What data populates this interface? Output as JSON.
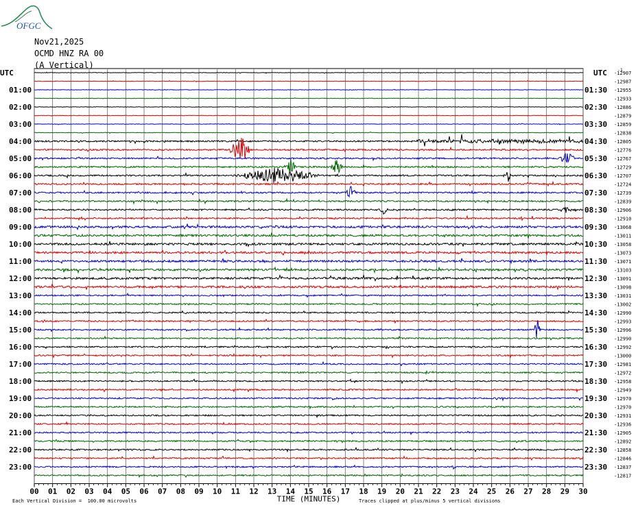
{
  "logo": {
    "text": "OFGC",
    "colors": {
      "swoosh": "#2e8b57",
      "text": "#1f4fbf"
    }
  },
  "header": {
    "date": "Nov21,2025",
    "station": "OCMD HNZ RA 00",
    "component": "(A Vertical)"
  },
  "chart_data": {
    "type": "line",
    "title": "Nov21,2025 OCMD HNZ RA 00 (A Vertical)",
    "left_axis_label": "UTC",
    "right_axis_label": "UTC",
    "left_times": [
      "01:00",
      "02:00",
      "03:00",
      "04:00",
      "05:00",
      "06:00",
      "07:00",
      "08:00",
      "09:00",
      "10:00",
      "11:00",
      "12:00",
      "13:00",
      "14:00",
      "15:00",
      "16:00",
      "17:00",
      "18:00",
      "19:00",
      "20:00",
      "21:00",
      "22:00",
      "23:00"
    ],
    "right_times": [
      "01:30",
      "02:30",
      "03:30",
      "04:30",
      "05:30",
      "06:30",
      "07:30",
      "08:30",
      "09:30",
      "10:30",
      "11:30",
      "12:30",
      "13:30",
      "14:30",
      "15:30",
      "16:30",
      "17:30",
      "18:30",
      "19:30",
      "20:30",
      "21:30",
      "22:30",
      "23:30"
    ],
    "right_header_small": "-1",
    "trace_offsets": [
      "-12907",
      "-12987",
      "-12955",
      "-12933",
      "-12886",
      "-12879",
      "-12859",
      "-12838",
      "-12805",
      "-12776",
      "-12767",
      "-12729",
      "-12707",
      "-12724",
      "-12739",
      "-12839",
      "-12906",
      "-12910",
      "-13068",
      "-13011",
      "-13058",
      "-13073",
      "-13071",
      "-13103",
      "-13091",
      "-13098",
      "-13031",
      "-13002",
      "-12990",
      "-12993",
      "-12996",
      "-12990",
      "-12992",
      "-13000",
      "-12981",
      "-12972",
      "-12958",
      "-12949",
      "-12970",
      "-12970",
      "-12931",
      "-12936",
      "-12905",
      "-12892",
      "-12858",
      "-12846",
      "-12837",
      "-12817"
    ],
    "x_ticks": [
      "00",
      "01",
      "02",
      "03",
      "04",
      "05",
      "06",
      "07",
      "08",
      "09",
      "10",
      "11",
      "12",
      "13",
      "14",
      "15",
      "16",
      "17",
      "18",
      "19",
      "20",
      "21",
      "22",
      "23",
      "24",
      "25",
      "26",
      "27",
      "28",
      "29",
      "30"
    ],
    "xlabel": "TIME (MINUTES)",
    "xlim": [
      0,
      30
    ],
    "num_traces": 48,
    "trace_color_cycle": [
      "#000000",
      "#dd0000",
      "#0000cc",
      "#006600"
    ],
    "grid": true,
    "events": [
      {
        "trace": 8,
        "start_min": 20.9,
        "end_min": 30.0,
        "amp": 9,
        "noise": 2.2
      },
      {
        "trace": 9,
        "start_min": 10.6,
        "end_min": 11.9,
        "amp": 22,
        "noise": 0
      },
      {
        "trace": 10,
        "start_min": 28.6,
        "end_min": 29.6,
        "amp": 11,
        "noise": 0
      },
      {
        "trace": 11,
        "start_min": 13.6,
        "end_min": 14.4,
        "amp": 12,
        "noise": 0
      },
      {
        "trace": 11,
        "start_min": 16.2,
        "end_min": 16.9,
        "amp": 13,
        "noise": 0
      },
      {
        "trace": 12,
        "start_min": 10.7,
        "end_min": 15.8,
        "amp": 12,
        "noise": 0
      },
      {
        "trace": 12,
        "start_min": 25.6,
        "end_min": 26.2,
        "amp": 7,
        "noise": 0
      },
      {
        "trace": 14,
        "start_min": 17.0,
        "end_min": 17.6,
        "amp": 10,
        "noise": 0
      },
      {
        "trace": 16,
        "start_min": 18.8,
        "end_min": 19.4,
        "amp": 6,
        "noise": 0
      },
      {
        "trace": 16,
        "start_min": 28.7,
        "end_min": 29.4,
        "amp": 6,
        "noise": 0
      },
      {
        "trace": 30,
        "start_min": 27.3,
        "end_min": 27.7,
        "amp": 18,
        "noise": 0
      },
      {
        "trace": 46,
        "start_min": 22.8,
        "end_min": 23.1,
        "amp": 4,
        "noise": 0
      }
    ]
  },
  "footer": {
    "left_note": "Each Vertical Division =  100.00 microvolts",
    "center_label": "TIME (MINUTES)",
    "right_note": "Traces clipped at plus/minus 5 vertical divisions"
  }
}
